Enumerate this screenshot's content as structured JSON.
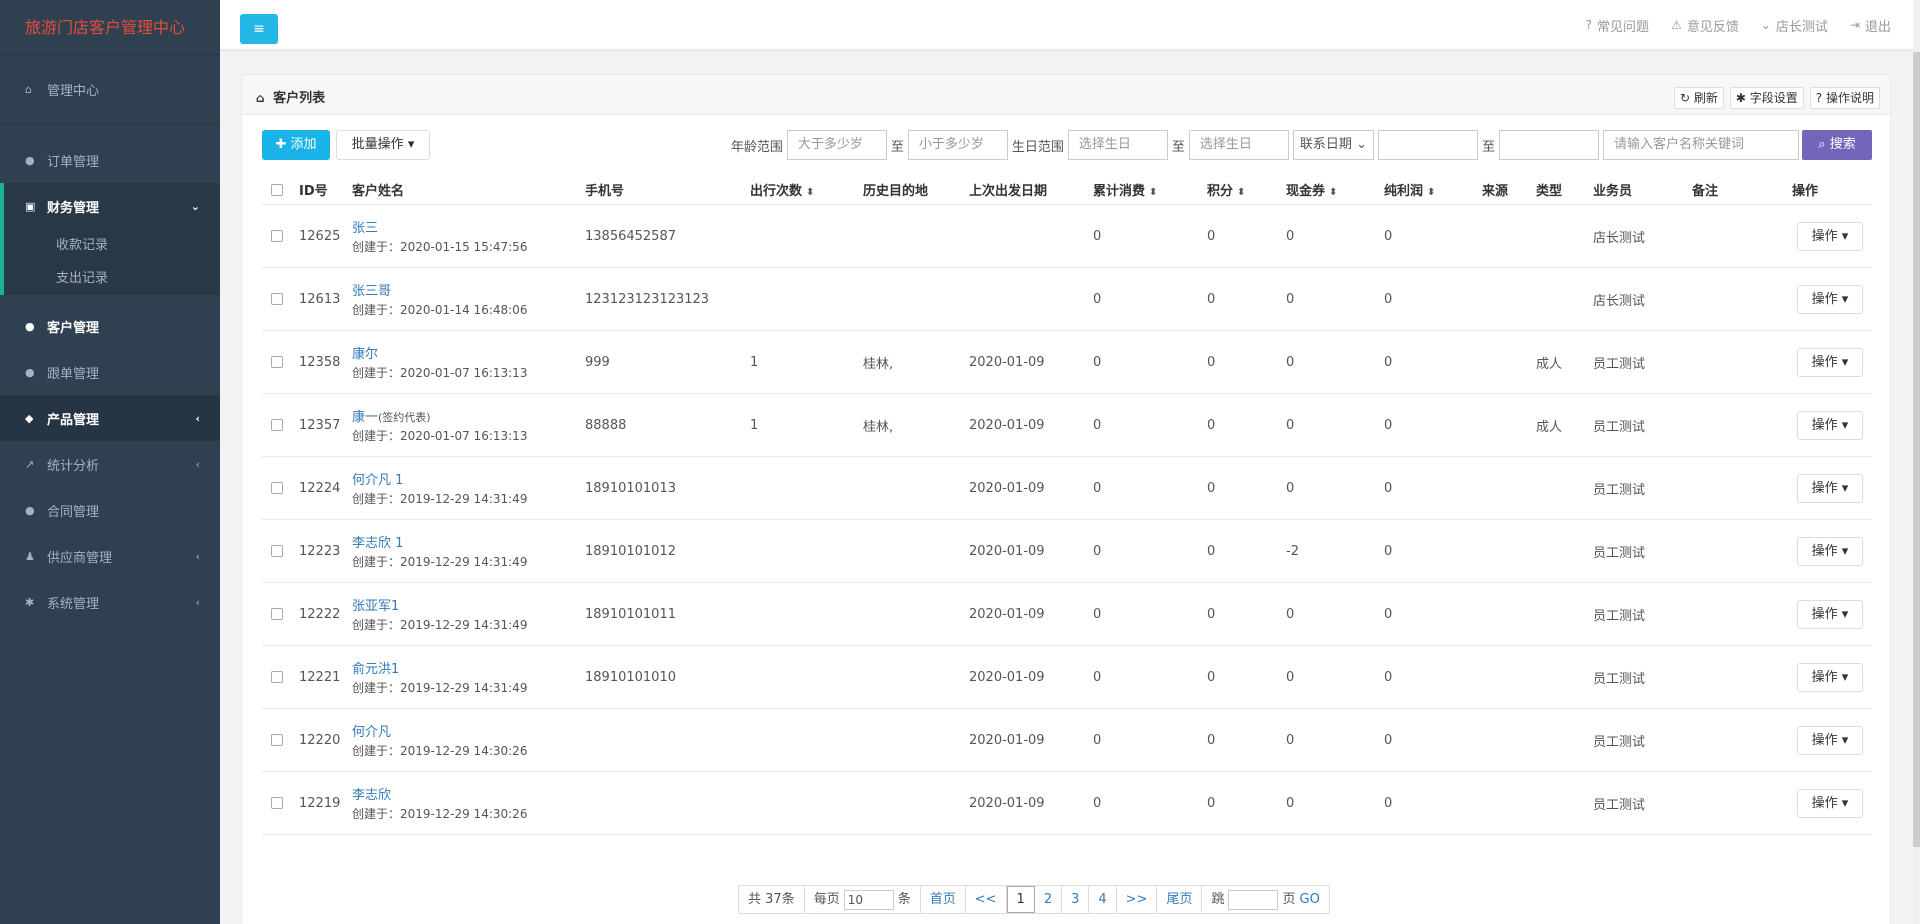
{
  "sidebar": {
    "brand": "旅游门店客户管理中心",
    "home": "管理中心",
    "items": [
      {
        "label": "订单管理"
      },
      {
        "label": "财务管理"
      },
      {
        "label": "客户管理"
      },
      {
        "label": "跟单管理"
      },
      {
        "label": "产品管理"
      },
      {
        "label": "统计分析"
      },
      {
        "label": "合同管理"
      },
      {
        "label": "供应商管理"
      },
      {
        "label": "系统管理"
      }
    ],
    "finance_sub": [
      "收款记录",
      "支出记录"
    ]
  },
  "topbar": {
    "links": [
      "常见问题",
      "意见反馈",
      "店长测试",
      "退出"
    ]
  },
  "panel": {
    "title": "客户列表",
    "tools": [
      "刷新",
      "字段设置",
      "操作说明"
    ]
  },
  "toolbar": {
    "add": "添加",
    "batch": "批量操作",
    "age_label": "年龄范围",
    "age_min_ph": "大于多少岁",
    "to1": "至",
    "age_max_ph": "小于多少岁",
    "birth_label": "生日范围",
    "birth_start_ph": "选择生日",
    "to2": "至",
    "birth_end_ph": "选择生日",
    "date_select": "联系日期",
    "to3": "至",
    "keyword_ph": "请输入客户名称关键词",
    "search": "搜索"
  },
  "table": {
    "headers": {
      "id": "ID号",
      "name": "客户姓名",
      "phone": "手机号",
      "trips": "出行次数",
      "dest": "历史目的地",
      "last_date": "上次出发日期",
      "spend": "累计消费",
      "points": "积分",
      "cash": "现金券",
      "profit": "纯利润",
      "source": "来源",
      "type": "类型",
      "sales": "业务员",
      "remark": "备注",
      "ops": "操作"
    },
    "op_label": "操作",
    "rows": [
      {
        "id": "12625",
        "name": "张三",
        "note": "",
        "created": "创建于：2020-01-15 15:47:56",
        "phone": "13856452587",
        "trips": "",
        "dest": "",
        "last_date": "",
        "spend": "0",
        "points": "0",
        "cash": "0",
        "profit": "0",
        "source": "",
        "type": "",
        "sales": "店长测试",
        "remark": ""
      },
      {
        "id": "12613",
        "name": "张三哥",
        "note": "",
        "created": "创建于：2020-01-14 16:48:06",
        "phone": "123123123123123",
        "trips": "",
        "dest": "",
        "last_date": "",
        "spend": "0",
        "points": "0",
        "cash": "0",
        "profit": "0",
        "source": "",
        "type": "",
        "sales": "店长测试",
        "remark": ""
      },
      {
        "id": "12358",
        "name": "康尔",
        "note": "",
        "created": "创建于：2020-01-07 16:13:13",
        "phone": "999",
        "trips": "1",
        "dest": "桂林,",
        "last_date": "2020-01-09",
        "spend": "0",
        "points": "0",
        "cash": "0",
        "profit": "0",
        "source": "",
        "type": "成人",
        "sales": "员工测试",
        "remark": ""
      },
      {
        "id": "12357",
        "name": "康一",
        "note": "(签约代表)",
        "created": "创建于：2020-01-07 16:13:13",
        "phone": "88888",
        "trips": "1",
        "dest": "桂林,",
        "last_date": "2020-01-09",
        "spend": "0",
        "points": "0",
        "cash": "0",
        "profit": "0",
        "source": "",
        "type": "成人",
        "sales": "员工测试",
        "remark": ""
      },
      {
        "id": "12224",
        "name": "何介凡 1",
        "note": "",
        "created": "创建于：2019-12-29 14:31:49",
        "phone": "18910101013",
        "trips": "",
        "dest": "",
        "last_date": "2020-01-09",
        "spend": "0",
        "points": "0",
        "cash": "0",
        "profit": "0",
        "source": "",
        "type": "",
        "sales": "员工测试",
        "remark": ""
      },
      {
        "id": "12223",
        "name": "李志欣 1",
        "note": "",
        "created": "创建于：2019-12-29 14:31:49",
        "phone": "18910101012",
        "trips": "",
        "dest": "",
        "last_date": "2020-01-09",
        "spend": "0",
        "points": "0",
        "cash": "-2",
        "profit": "0",
        "source": "",
        "type": "",
        "sales": "员工测试",
        "remark": ""
      },
      {
        "id": "12222",
        "name": "张亚军1",
        "note": "",
        "created": "创建于：2019-12-29 14:31:49",
        "phone": "18910101011",
        "trips": "",
        "dest": "",
        "last_date": "2020-01-09",
        "spend": "0",
        "points": "0",
        "cash": "0",
        "profit": "0",
        "source": "",
        "type": "",
        "sales": "员工测试",
        "remark": ""
      },
      {
        "id": "12221",
        "name": "俞元洪1",
        "note": "",
        "created": "创建于：2019-12-29 14:31:49",
        "phone": "18910101010",
        "trips": "",
        "dest": "",
        "last_date": "2020-01-09",
        "spend": "0",
        "points": "0",
        "cash": "0",
        "profit": "0",
        "source": "",
        "type": "",
        "sales": "员工测试",
        "remark": ""
      },
      {
        "id": "12220",
        "name": "何介凡",
        "note": "",
        "created": "创建于：2019-12-29 14:30:26",
        "phone": "",
        "trips": "",
        "dest": "",
        "last_date": "2020-01-09",
        "spend": "0",
        "points": "0",
        "cash": "0",
        "profit": "0",
        "source": "",
        "type": "",
        "sales": "员工测试",
        "remark": ""
      },
      {
        "id": "12219",
        "name": "李志欣",
        "note": "",
        "created": "创建于：2019-12-29 14:30:26",
        "phone": "",
        "trips": "",
        "dest": "",
        "last_date": "2020-01-09",
        "spend": "0",
        "points": "0",
        "cash": "0",
        "profit": "0",
        "source": "",
        "type": "",
        "sales": "员工测试",
        "remark": ""
      }
    ]
  },
  "pager": {
    "total": "共 37条",
    "per_page_label": "每页",
    "per_page": "10",
    "per_page_unit": "条",
    "first": "首页",
    "prev": "<<",
    "pages": [
      "1",
      "2",
      "3",
      "4"
    ],
    "next": ">>",
    "last": "尾页",
    "jump": "跳",
    "page_unit": "页",
    "go": "GO"
  },
  "colors": {
    "sidebar_bg": "#2f4050",
    "brand": "#e74c3c",
    "accent": "#23b7e5",
    "search": "#7266ba",
    "link": "#337ab7"
  },
  "icons": {
    "menu": "hamburger-icon",
    "home": "home-icon",
    "search": "search-icon",
    "plus": "plus-icon",
    "question": "question-circle-icon",
    "warning": "warning-icon",
    "user": "chevron-down-icon",
    "logout": "logout-icon",
    "refresh": "refresh-icon",
    "gear": "gear-icon"
  }
}
